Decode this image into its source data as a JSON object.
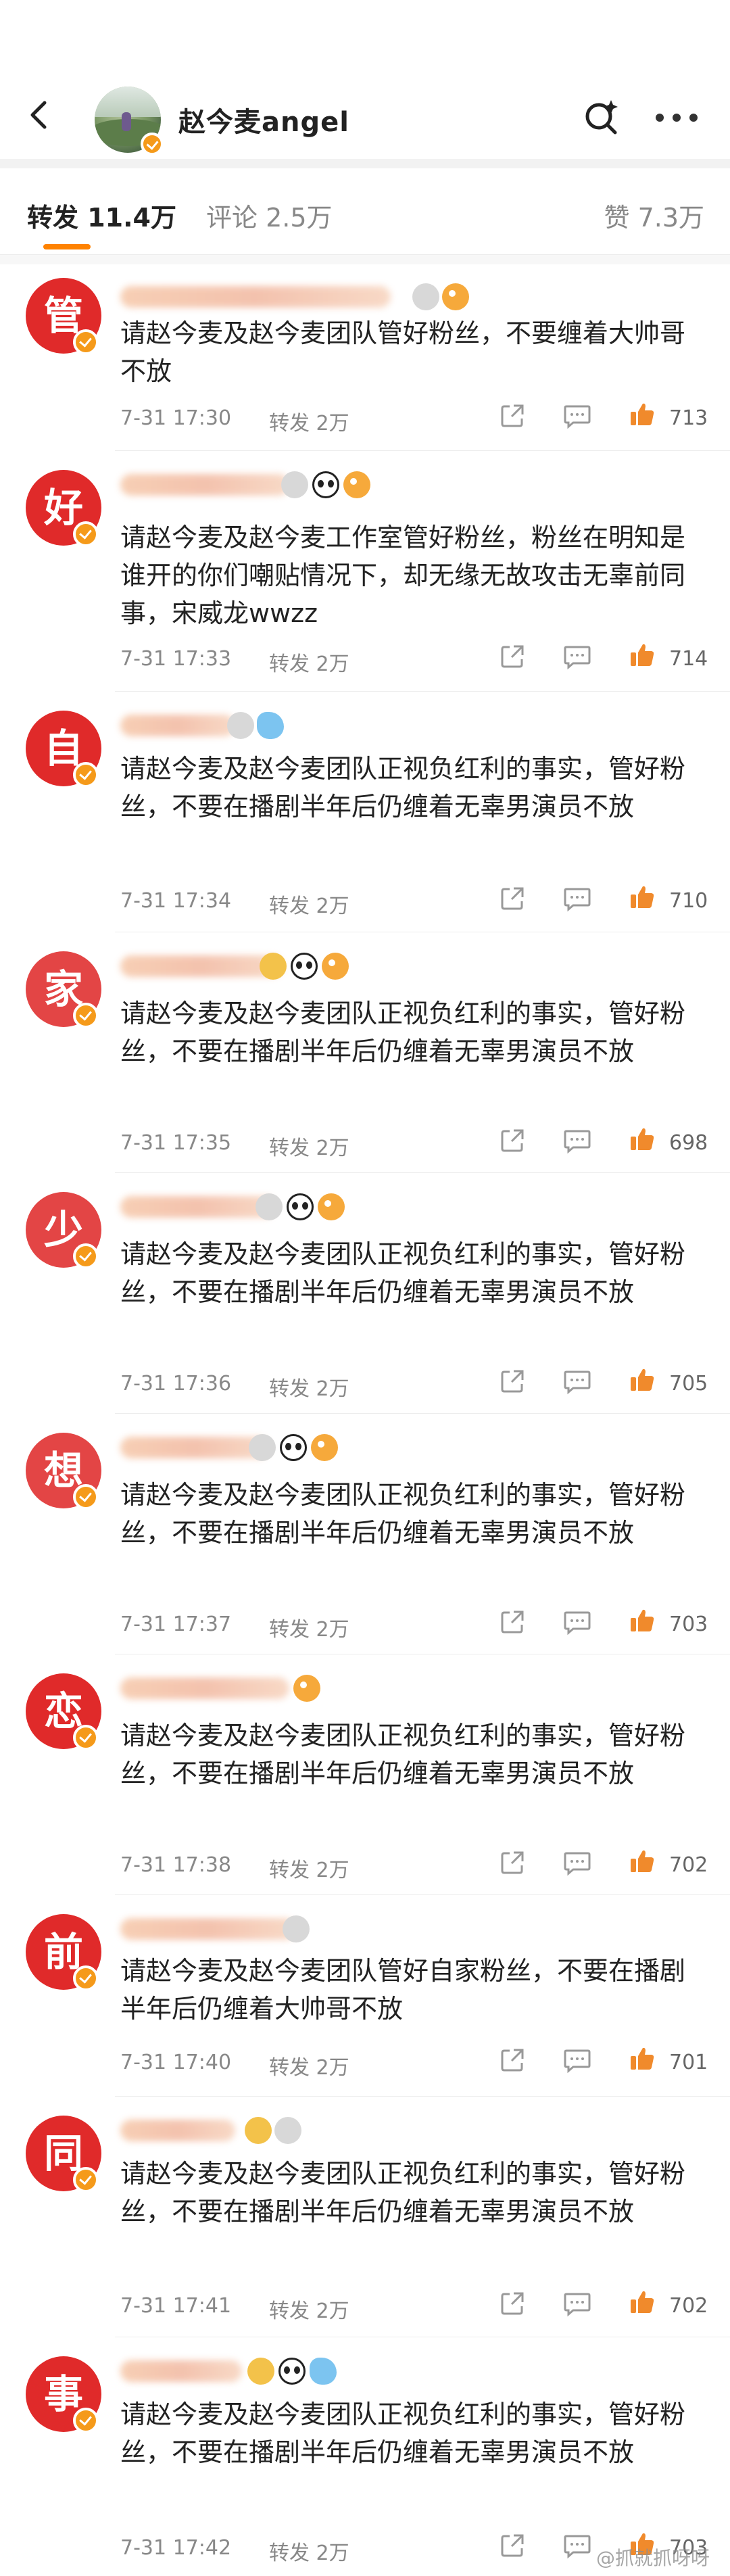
{
  "header": {
    "title": "赵今麦angel"
  },
  "tabs": {
    "reposts": "转发 11.4万",
    "comments": "评论 2.5万",
    "likes": "赞 7.3万"
  },
  "entries": [
    {
      "avatar_char": "管",
      "text": "请赵今麦及赵今麦团队管好粉丝，不要缠着大帅哥不放",
      "time": "7-31 17:30",
      "forward": "转发 2万",
      "likes": "713"
    },
    {
      "avatar_char": "好",
      "text": "请赵今麦及赵今麦工作室管好粉丝，粉丝在明知是谁开的你们嘲贴情况下，却无缘无故攻击无辜前同事，宋威龙wwzz",
      "time": "7-31 17:33",
      "forward": "转发 2万",
      "likes": "714"
    },
    {
      "avatar_char": "自",
      "text": "请赵今麦及赵今麦团队正视负红利的事实，管好粉丝，不要在播剧半年后仍缠着无辜男演员不放",
      "time": "7-31 17:34",
      "forward": "转发 2万",
      "likes": "710"
    },
    {
      "avatar_char": "家",
      "text": "请赵今麦及赵今麦团队正视负红利的事实，管好粉丝，不要在播剧半年后仍缠着无辜男演员不放",
      "time": "7-31 17:35",
      "forward": "转发 2万",
      "likes": "698"
    },
    {
      "avatar_char": "少",
      "text": "请赵今麦及赵今麦团队正视负红利的事实，管好粉丝，不要在播剧半年后仍缠着无辜男演员不放",
      "time": "7-31 17:36",
      "forward": "转发 2万",
      "likes": "705"
    },
    {
      "avatar_char": "想",
      "text": "请赵今麦及赵今麦团队正视负红利的事实，管好粉丝，不要在播剧半年后仍缠着无辜男演员不放",
      "time": "7-31 17:37",
      "forward": "转发 2万",
      "likes": "703"
    },
    {
      "avatar_char": "恋",
      "text": "请赵今麦及赵今麦团队正视负红利的事实，管好粉丝，不要在播剧半年后仍缠着无辜男演员不放",
      "time": "7-31 17:38",
      "forward": "转发 2万",
      "likes": "702"
    },
    {
      "avatar_char": "前",
      "text": "请赵今麦及赵今麦团队管好自家粉丝，不要在播剧半年后仍缠着大帅哥不放",
      "time": "7-31 17:40",
      "forward": "转发 2万",
      "likes": "701"
    },
    {
      "avatar_char": "同",
      "text": "请赵今麦及赵今麦团队正视负红利的事实，管好粉丝，不要在播剧半年后仍缠着无辜男演员不放",
      "time": "7-31 17:41",
      "forward": "转发 2万",
      "likes": "702"
    },
    {
      "avatar_char": "事",
      "text": "请赵今麦及赵今麦团队正视负红利的事实，管好粉丝，不要在播剧半年后仍缠着无辜男演员不放",
      "time": "7-31 17:42",
      "forward": "转发 2万",
      "likes": "703"
    }
  ],
  "watermark": "@抓就抓呀呀",
  "colors": {
    "accent": "#ff8200",
    "avatar_red": "#e02a2a",
    "verified_badge": "#f59a1a",
    "like_icon": "#f08a2c"
  }
}
